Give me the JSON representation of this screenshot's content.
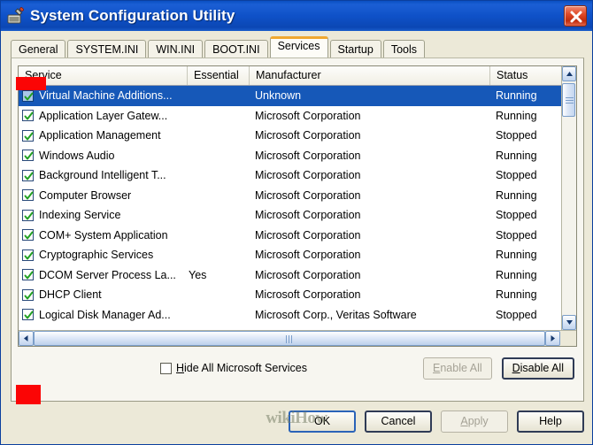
{
  "window": {
    "title": "System Configuration Utility",
    "icon": "msconfig-icon",
    "close_label": "×"
  },
  "tabs": [
    {
      "label": "General",
      "active": false
    },
    {
      "label": "SYSTEM.INI",
      "active": false
    },
    {
      "label": "WIN.INI",
      "active": false
    },
    {
      "label": "BOOT.INI",
      "active": false
    },
    {
      "label": "Services",
      "active": true
    },
    {
      "label": "Startup",
      "active": false
    },
    {
      "label": "Tools",
      "active": false
    }
  ],
  "list": {
    "columns": [
      "Service",
      "Essential",
      "Manufacturer",
      "Status"
    ],
    "rows": [
      {
        "checked": true,
        "service": "Virtual Machine Additions...",
        "essential": "",
        "manufacturer": "Unknown",
        "status": "Running",
        "selected": true
      },
      {
        "checked": true,
        "service": "Application Layer Gatew...",
        "essential": "",
        "manufacturer": "Microsoft Corporation",
        "status": "Running",
        "selected": false
      },
      {
        "checked": true,
        "service": "Application Management",
        "essential": "",
        "manufacturer": "Microsoft Corporation",
        "status": "Stopped",
        "selected": false
      },
      {
        "checked": true,
        "service": "Windows Audio",
        "essential": "",
        "manufacturer": "Microsoft Corporation",
        "status": "Running",
        "selected": false
      },
      {
        "checked": true,
        "service": "Background Intelligent T...",
        "essential": "",
        "manufacturer": "Microsoft Corporation",
        "status": "Stopped",
        "selected": false
      },
      {
        "checked": true,
        "service": "Computer Browser",
        "essential": "",
        "manufacturer": "Microsoft Corporation",
        "status": "Running",
        "selected": false
      },
      {
        "checked": true,
        "service": "Indexing Service",
        "essential": "",
        "manufacturer": "Microsoft Corporation",
        "status": "Stopped",
        "selected": false
      },
      {
        "checked": true,
        "service": "COM+ System Application",
        "essential": "",
        "manufacturer": "Microsoft Corporation",
        "status": "Stopped",
        "selected": false
      },
      {
        "checked": true,
        "service": "Cryptographic Services",
        "essential": "",
        "manufacturer": "Microsoft Corporation",
        "status": "Running",
        "selected": false
      },
      {
        "checked": true,
        "service": "DCOM Server Process La...",
        "essential": "Yes",
        "manufacturer": "Microsoft Corporation",
        "status": "Running",
        "selected": false
      },
      {
        "checked": true,
        "service": "DHCP Client",
        "essential": "",
        "manufacturer": "Microsoft Corporation",
        "status": "Running",
        "selected": false
      },
      {
        "checked": true,
        "service": "Logical Disk Manager Ad...",
        "essential": "",
        "manufacturer": "Microsoft Corp., Veritas Software",
        "status": "Stopped",
        "selected": false
      }
    ]
  },
  "options": {
    "hide_microsoft_label": "Hide All Microsoft Services",
    "hide_microsoft_checked": false,
    "enable_all_label": "Enable All",
    "enable_all_disabled": true,
    "disable_all_label": "Disable All",
    "disable_all_disabled": false
  },
  "footer": {
    "ok_label": "OK",
    "cancel_label": "Cancel",
    "apply_label": "Apply",
    "apply_disabled": true,
    "help_label": "Help"
  },
  "watermark": "wikiHow",
  "colors": {
    "titlebar_blue": "#0f51c8",
    "selection_blue": "#1658b8",
    "active_tab_accent": "#f0a830",
    "annotation_red": "#fb0505",
    "check_green": "#22a022",
    "dialog_bg": "#ece9d8"
  }
}
